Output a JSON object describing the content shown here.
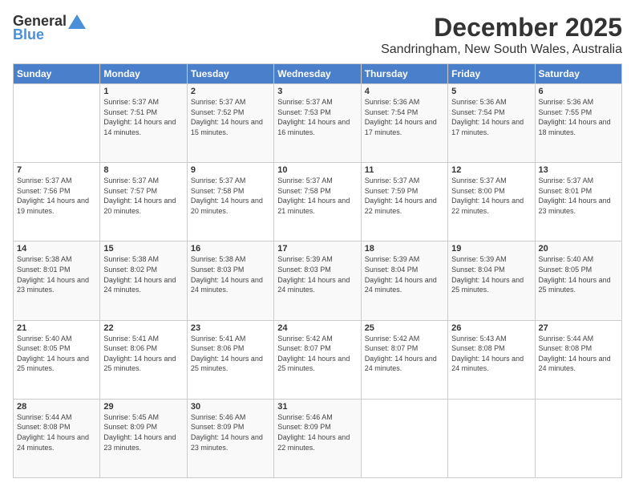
{
  "header": {
    "logo_line1": "General",
    "logo_line2": "Blue",
    "title": "December 2025",
    "subtitle": "Sandringham, New South Wales, Australia"
  },
  "weekdays": [
    "Sunday",
    "Monday",
    "Tuesday",
    "Wednesday",
    "Thursday",
    "Friday",
    "Saturday"
  ],
  "weeks": [
    [
      {
        "day": "",
        "sunrise": "",
        "sunset": "",
        "daylight": ""
      },
      {
        "day": "1",
        "sunrise": "Sunrise: 5:37 AM",
        "sunset": "Sunset: 7:51 PM",
        "daylight": "Daylight: 14 hours and 14 minutes."
      },
      {
        "day": "2",
        "sunrise": "Sunrise: 5:37 AM",
        "sunset": "Sunset: 7:52 PM",
        "daylight": "Daylight: 14 hours and 15 minutes."
      },
      {
        "day": "3",
        "sunrise": "Sunrise: 5:37 AM",
        "sunset": "Sunset: 7:53 PM",
        "daylight": "Daylight: 14 hours and 16 minutes."
      },
      {
        "day": "4",
        "sunrise": "Sunrise: 5:36 AM",
        "sunset": "Sunset: 7:54 PM",
        "daylight": "Daylight: 14 hours and 17 minutes."
      },
      {
        "day": "5",
        "sunrise": "Sunrise: 5:36 AM",
        "sunset": "Sunset: 7:54 PM",
        "daylight": "Daylight: 14 hours and 17 minutes."
      },
      {
        "day": "6",
        "sunrise": "Sunrise: 5:36 AM",
        "sunset": "Sunset: 7:55 PM",
        "daylight": "Daylight: 14 hours and 18 minutes."
      }
    ],
    [
      {
        "day": "7",
        "sunrise": "Sunrise: 5:37 AM",
        "sunset": "Sunset: 7:56 PM",
        "daylight": "Daylight: 14 hours and 19 minutes."
      },
      {
        "day": "8",
        "sunrise": "Sunrise: 5:37 AM",
        "sunset": "Sunset: 7:57 PM",
        "daylight": "Daylight: 14 hours and 20 minutes."
      },
      {
        "day": "9",
        "sunrise": "Sunrise: 5:37 AM",
        "sunset": "Sunset: 7:58 PM",
        "daylight": "Daylight: 14 hours and 20 minutes."
      },
      {
        "day": "10",
        "sunrise": "Sunrise: 5:37 AM",
        "sunset": "Sunset: 7:58 PM",
        "daylight": "Daylight: 14 hours and 21 minutes."
      },
      {
        "day": "11",
        "sunrise": "Sunrise: 5:37 AM",
        "sunset": "Sunset: 7:59 PM",
        "daylight": "Daylight: 14 hours and 22 minutes."
      },
      {
        "day": "12",
        "sunrise": "Sunrise: 5:37 AM",
        "sunset": "Sunset: 8:00 PM",
        "daylight": "Daylight: 14 hours and 22 minutes."
      },
      {
        "day": "13",
        "sunrise": "Sunrise: 5:37 AM",
        "sunset": "Sunset: 8:01 PM",
        "daylight": "Daylight: 14 hours and 23 minutes."
      }
    ],
    [
      {
        "day": "14",
        "sunrise": "Sunrise: 5:38 AM",
        "sunset": "Sunset: 8:01 PM",
        "daylight": "Daylight: 14 hours and 23 minutes."
      },
      {
        "day": "15",
        "sunrise": "Sunrise: 5:38 AM",
        "sunset": "Sunset: 8:02 PM",
        "daylight": "Daylight: 14 hours and 24 minutes."
      },
      {
        "day": "16",
        "sunrise": "Sunrise: 5:38 AM",
        "sunset": "Sunset: 8:03 PM",
        "daylight": "Daylight: 14 hours and 24 minutes."
      },
      {
        "day": "17",
        "sunrise": "Sunrise: 5:39 AM",
        "sunset": "Sunset: 8:03 PM",
        "daylight": "Daylight: 14 hours and 24 minutes."
      },
      {
        "day": "18",
        "sunrise": "Sunrise: 5:39 AM",
        "sunset": "Sunset: 8:04 PM",
        "daylight": "Daylight: 14 hours and 24 minutes."
      },
      {
        "day": "19",
        "sunrise": "Sunrise: 5:39 AM",
        "sunset": "Sunset: 8:04 PM",
        "daylight": "Daylight: 14 hours and 25 minutes."
      },
      {
        "day": "20",
        "sunrise": "Sunrise: 5:40 AM",
        "sunset": "Sunset: 8:05 PM",
        "daylight": "Daylight: 14 hours and 25 minutes."
      }
    ],
    [
      {
        "day": "21",
        "sunrise": "Sunrise: 5:40 AM",
        "sunset": "Sunset: 8:05 PM",
        "daylight": "Daylight: 14 hours and 25 minutes."
      },
      {
        "day": "22",
        "sunrise": "Sunrise: 5:41 AM",
        "sunset": "Sunset: 8:06 PM",
        "daylight": "Daylight: 14 hours and 25 minutes."
      },
      {
        "day": "23",
        "sunrise": "Sunrise: 5:41 AM",
        "sunset": "Sunset: 8:06 PM",
        "daylight": "Daylight: 14 hours and 25 minutes."
      },
      {
        "day": "24",
        "sunrise": "Sunrise: 5:42 AM",
        "sunset": "Sunset: 8:07 PM",
        "daylight": "Daylight: 14 hours and 25 minutes."
      },
      {
        "day": "25",
        "sunrise": "Sunrise: 5:42 AM",
        "sunset": "Sunset: 8:07 PM",
        "daylight": "Daylight: 14 hours and 24 minutes."
      },
      {
        "day": "26",
        "sunrise": "Sunrise: 5:43 AM",
        "sunset": "Sunset: 8:08 PM",
        "daylight": "Daylight: 14 hours and 24 minutes."
      },
      {
        "day": "27",
        "sunrise": "Sunrise: 5:44 AM",
        "sunset": "Sunset: 8:08 PM",
        "daylight": "Daylight: 14 hours and 24 minutes."
      }
    ],
    [
      {
        "day": "28",
        "sunrise": "Sunrise: 5:44 AM",
        "sunset": "Sunset: 8:08 PM",
        "daylight": "Daylight: 14 hours and 24 minutes."
      },
      {
        "day": "29",
        "sunrise": "Sunrise: 5:45 AM",
        "sunset": "Sunset: 8:09 PM",
        "daylight": "Daylight: 14 hours and 23 minutes."
      },
      {
        "day": "30",
        "sunrise": "Sunrise: 5:46 AM",
        "sunset": "Sunset: 8:09 PM",
        "daylight": "Daylight: 14 hours and 23 minutes."
      },
      {
        "day": "31",
        "sunrise": "Sunrise: 5:46 AM",
        "sunset": "Sunset: 8:09 PM",
        "daylight": "Daylight: 14 hours and 22 minutes."
      },
      {
        "day": "",
        "sunrise": "",
        "sunset": "",
        "daylight": ""
      },
      {
        "day": "",
        "sunrise": "",
        "sunset": "",
        "daylight": ""
      },
      {
        "day": "",
        "sunrise": "",
        "sunset": "",
        "daylight": ""
      }
    ]
  ]
}
